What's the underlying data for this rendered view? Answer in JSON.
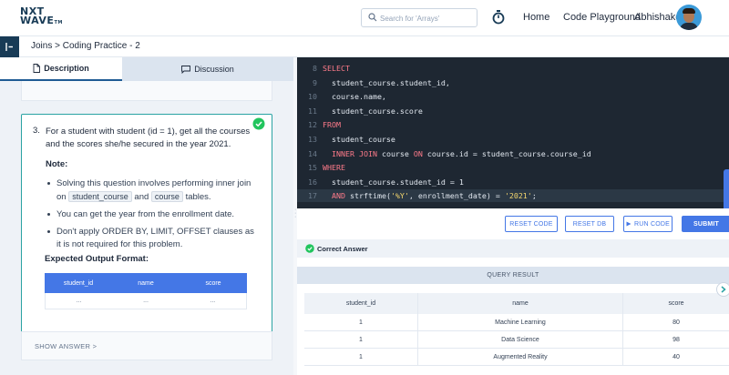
{
  "header": {
    "logo_line1": "NXT",
    "logo_line2": "WAVE",
    "logo_tm": "TM",
    "search_placeholder": "Search for 'Arrays'",
    "nav": {
      "home": "Home",
      "playground": "Code Playground",
      "user": "Abhishake"
    }
  },
  "breadcrumb": "Joins > Coding Practice - 2",
  "tabs": {
    "description": "Description",
    "discussion": "Discussion"
  },
  "question": {
    "number": "3.",
    "text": "For a student with student (id = 1), get all the courses and the scores she/he secured in the year 2021.",
    "note_title": "Note:",
    "bullet1_a": "Solving this question involves performing inner join on",
    "bullet1_chip1": "student_course",
    "bullet1_and": "and",
    "bullet1_chip2": "course",
    "bullet1_b": "tables.",
    "bullet2": "You can get the year from the enrollment date.",
    "bullet3": "Don't apply ORDER BY, LIMIT, OFFSET clauses as it is not required for this problem.",
    "expected_title": "Expected Output Format:",
    "expected_columns": [
      "student_id",
      "name",
      "score"
    ],
    "expected_row": [
      "...",
      "...",
      "..."
    ],
    "show_answer": "SHOW ANSWER >"
  },
  "editor": {
    "lines": [
      {
        "n": "8",
        "tokens": [
          [
            "kw",
            "SELECT"
          ]
        ]
      },
      {
        "n": "9",
        "tokens": [
          [
            "",
            "  student_course.student_id,"
          ]
        ]
      },
      {
        "n": "10",
        "tokens": [
          [
            "",
            "  course.name,"
          ]
        ]
      },
      {
        "n": "11",
        "tokens": [
          [
            "",
            "  student_course.score"
          ]
        ]
      },
      {
        "n": "12",
        "tokens": [
          [
            "kw",
            "FROM"
          ]
        ]
      },
      {
        "n": "13",
        "tokens": [
          [
            "",
            "  student_course"
          ]
        ]
      },
      {
        "n": "14",
        "tokens": [
          [
            "kw",
            "  INNER JOIN"
          ],
          [
            "",
            " course "
          ],
          [
            "kw",
            "ON"
          ],
          [
            "",
            " course.id = student_course.course_id"
          ]
        ]
      },
      {
        "n": "15",
        "tokens": [
          [
            "kw",
            "WHERE"
          ]
        ]
      },
      {
        "n": "16",
        "tokens": [
          [
            "",
            "  student_course.student_id = 1"
          ]
        ]
      },
      {
        "n": "17",
        "tokens": [
          [
            "kw",
            "  AND"
          ],
          [
            "",
            " strftime("
          ],
          [
            "str",
            "'%Y'"
          ],
          [
            "",
            ", enrollment_date) = "
          ],
          [
            "str",
            "'2021'"
          ],
          [
            "",
            ";"
          ]
        ]
      }
    ],
    "active_line": "17"
  },
  "buttons": {
    "reset_code": "RESET CODE",
    "reset_db": "RESET DB",
    "run_code": "RUN CODE",
    "submit": "SUBMIT"
  },
  "status": "Correct Answer",
  "result": {
    "title": "QUERY RESULT",
    "columns": [
      "student_id",
      "name",
      "score"
    ],
    "rows": [
      [
        "1",
        "Machine Learning",
        "80"
      ],
      [
        "1",
        "Data Science",
        "98"
      ],
      [
        "1",
        "Augmented Reality",
        "40"
      ]
    ]
  },
  "colors": {
    "brand": "#183b56",
    "accent": "#4477e6",
    "success": "#22c55e",
    "editor_bg": "#1e2732",
    "keyword": "#ff7b8a",
    "string": "#f5d76e"
  },
  "icons": [
    "search-icon",
    "timer-icon",
    "sidebar-toggle-icon",
    "document-icon",
    "chat-icon",
    "check-circle-icon",
    "play-icon",
    "chevron-right-icon"
  ]
}
